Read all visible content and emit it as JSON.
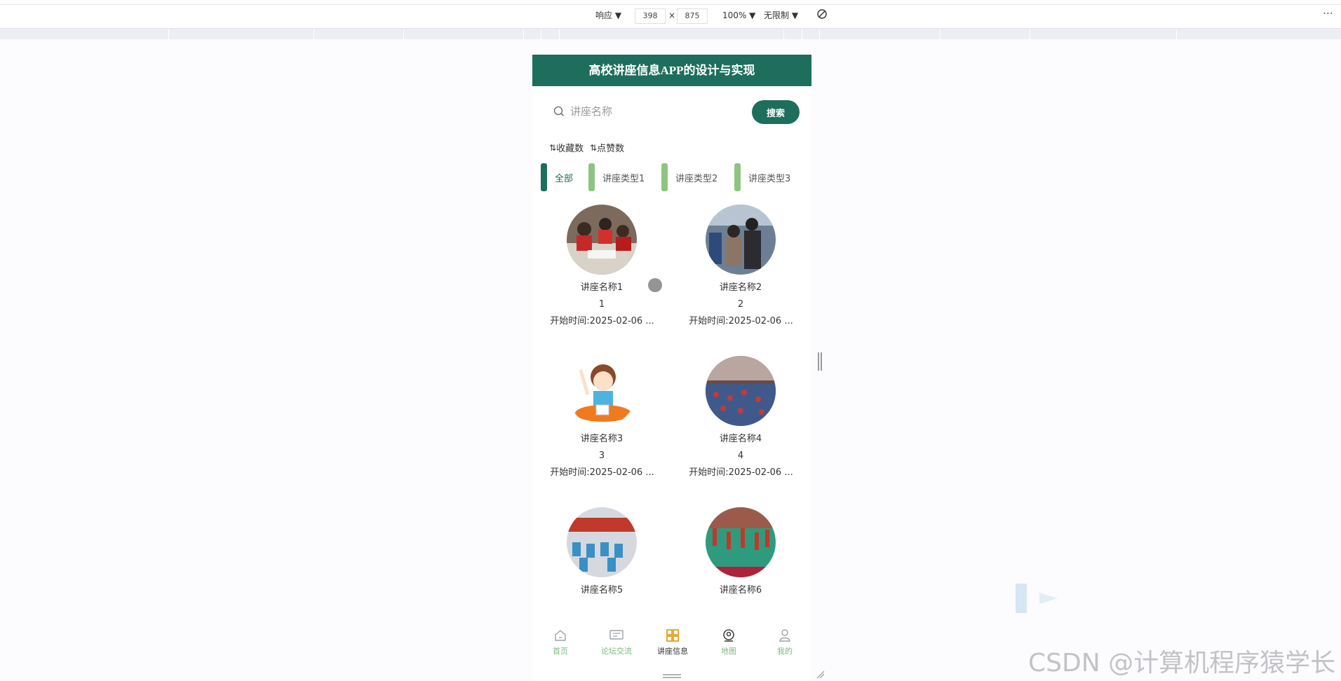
{
  "devtools": {
    "mode_label": "响应 ▼",
    "width_value": "398",
    "times": "×",
    "height_value": "875",
    "zoom_label": "100% ▼",
    "throttle_label": "无限制 ▼",
    "more_label": "⋮"
  },
  "app": {
    "title": "高校讲座信息APP的设计与实现",
    "search": {
      "placeholder": "讲座名称",
      "button": "搜索"
    },
    "sort": [
      {
        "icon": "⇅",
        "label": "收藏数"
      },
      {
        "icon": "⇅",
        "label": "点赞数"
      }
    ],
    "tabs": [
      {
        "label": "全部",
        "active": true,
        "bar_color": "#1d6e5c"
      },
      {
        "label": "讲座类型1",
        "active": false,
        "bar_color": "#8dc57f"
      },
      {
        "label": "讲座类型2",
        "active": false,
        "bar_color": "#8dc57f"
      },
      {
        "label": "讲座类型3",
        "active": false,
        "bar_color": "#8dc57f"
      }
    ],
    "items": [
      {
        "name": "讲座名称1",
        "num": "1",
        "time": "开始时间:2025-02-06 ..."
      },
      {
        "name": "讲座名称2",
        "num": "2",
        "time": "开始时间:2025-02-06 ..."
      },
      {
        "name": "讲座名称3",
        "num": "3",
        "time": "开始时间:2025-02-06 ..."
      },
      {
        "name": "讲座名称4",
        "num": "4",
        "time": "开始时间:2025-02-06 ..."
      },
      {
        "name": "讲座名称5",
        "num": "",
        "time": ""
      },
      {
        "name": "讲座名称6",
        "num": "",
        "time": ""
      }
    ],
    "nav": [
      {
        "label": "首页",
        "icon": "home-icon",
        "active": false
      },
      {
        "label": "论坛交流",
        "icon": "forum-icon",
        "active": false
      },
      {
        "label": "讲座信息",
        "icon": "grid-icon",
        "active": true
      },
      {
        "label": "地图",
        "icon": "map-pin-icon",
        "active": false
      },
      {
        "label": "我的",
        "icon": "user-icon",
        "active": false
      }
    ]
  },
  "watermark": "CSDN @计算机程序猿学长",
  "colors": {
    "primary": "#1d6e5c",
    "accent": "#8dc57f",
    "nav_label": "#7ab87f"
  }
}
